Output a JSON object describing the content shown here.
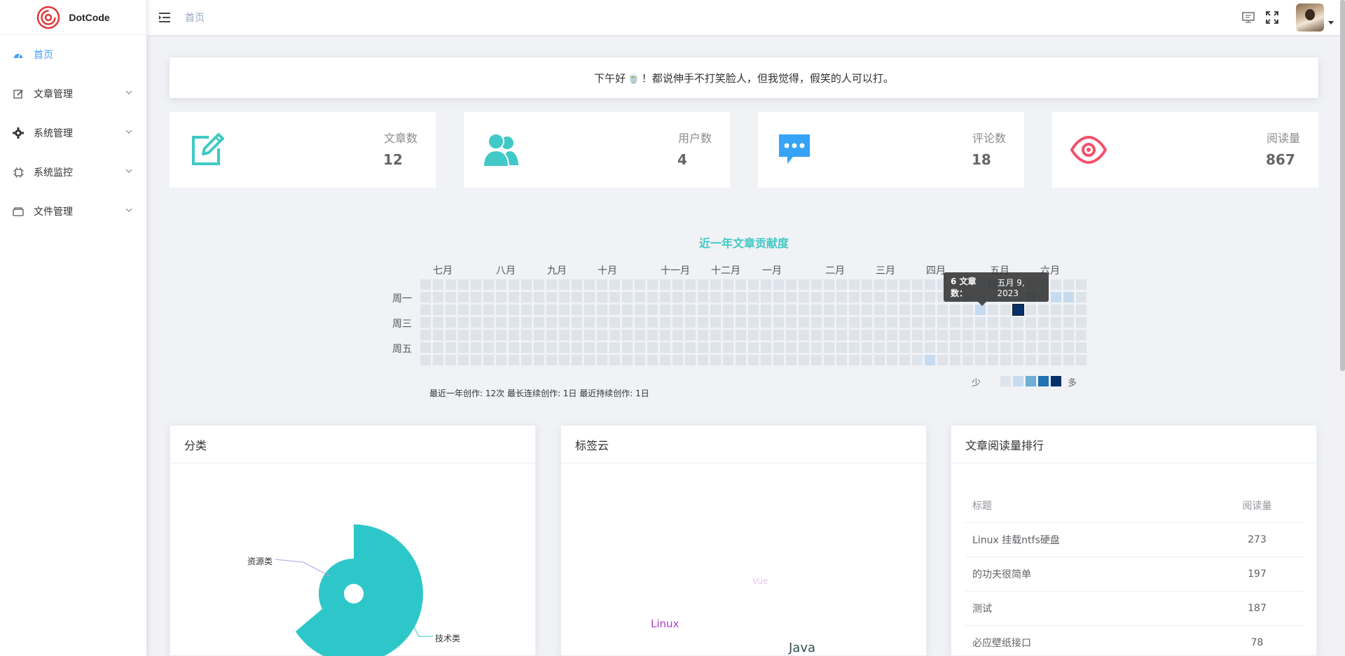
{
  "app": {
    "title": "DotCode"
  },
  "sidebar": {
    "items": [
      {
        "label": "首页",
        "active": true
      },
      {
        "label": "文章管理"
      },
      {
        "label": "系统管理"
      },
      {
        "label": "系统监控"
      },
      {
        "label": "文件管理"
      }
    ]
  },
  "topbar": {
    "breadcrumb": "首页"
  },
  "greeting": {
    "prefix": "下午好",
    "emoji": "🍵",
    "text": "！都说伸手不打笑脸人，但我觉得，假笑的人可以打。"
  },
  "stats": [
    {
      "label": "文章数",
      "value": "12",
      "color": "#40c9c6"
    },
    {
      "label": "用户数",
      "value": "4",
      "color": "#40c9c6"
    },
    {
      "label": "评论数",
      "value": "18",
      "color": "#36a3f7"
    },
    {
      "label": "阅读量",
      "value": "867",
      "color": "#f4516c"
    }
  ],
  "heatmap": {
    "title": "近一年文章贡献度",
    "months": [
      "七月",
      "八月",
      "九月",
      "十月",
      "十一月",
      "十二月",
      "一月",
      "二月",
      "三月",
      "四月",
      "五月",
      "六月"
    ],
    "days": [
      "周一",
      "周三",
      "周五"
    ],
    "legend_low": "少",
    "legend_high": "多",
    "legend_colors": [
      "#dfe3ea",
      "#c6dbef",
      "#6baed6",
      "#2171b5",
      "#08306b"
    ],
    "summary": "最近一年创作: 12次 最长连续创作: 1日 最近持续创作: 1日",
    "tooltip_label": "6 文章数：",
    "tooltip_date": "五月 9, 2023"
  },
  "panels": {
    "category": {
      "title": "分类",
      "labels": [
        "资源类",
        "技术类"
      ]
    },
    "tags": {
      "title": "标签云",
      "tags": [
        "Vue",
        "Linux",
        "Java"
      ]
    },
    "ranking": {
      "title": "文章阅读量排行",
      "headers": [
        "标题",
        "阅读量"
      ],
      "rows": [
        {
          "title": "Linux 挂载ntfs硬盘",
          "views": "273"
        },
        {
          "title": "的功夫很简单",
          "views": "197"
        },
        {
          "title": "测试",
          "views": "187"
        },
        {
          "title": "必应壁纸接口",
          "views": "78"
        }
      ]
    }
  }
}
